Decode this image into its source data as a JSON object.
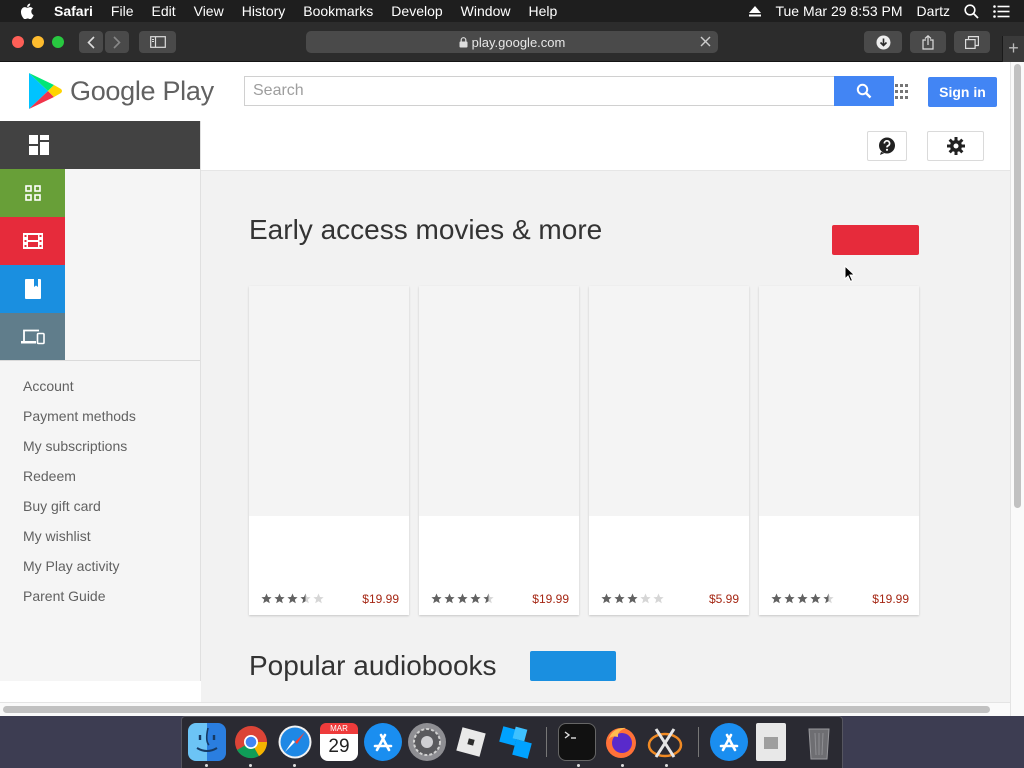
{
  "menubar": {
    "items": [
      "Safari",
      "File",
      "Edit",
      "View",
      "History",
      "Bookmarks",
      "Develop",
      "Window",
      "Help"
    ],
    "datetime": "Tue Mar 29  8:53 PM",
    "user": "Dartz"
  },
  "safari": {
    "url": "play.google.com"
  },
  "header": {
    "logo_text": "Google Play",
    "search_placeholder": "Search",
    "signin_label": "Sign in"
  },
  "sidebar": {
    "links": [
      "Account",
      "Payment methods",
      "My subscriptions",
      "Redeem",
      "Buy gift card",
      "My wishlist",
      "My Play activity",
      "Parent Guide"
    ]
  },
  "main": {
    "section1_title": "Early access movies & more",
    "section2_title": "Popular audiobooks",
    "cards": [
      {
        "rating": 3.5,
        "price": "$19.99"
      },
      {
        "rating": 4.5,
        "price": "$19.99"
      },
      {
        "rating": 3.0,
        "price": "$5.99"
      },
      {
        "rating": 4.5,
        "price": "$19.99"
      }
    ]
  },
  "colors": {
    "play_blue": "#4285f4",
    "apps_green": "#689f38",
    "movies_red": "#e62b3b",
    "books_blue": "#1a8fe0",
    "devices_gray": "#607d8b",
    "price_red": "#a52714"
  },
  "dock": {
    "calendar_month": "MAR",
    "calendar_day": "29"
  }
}
